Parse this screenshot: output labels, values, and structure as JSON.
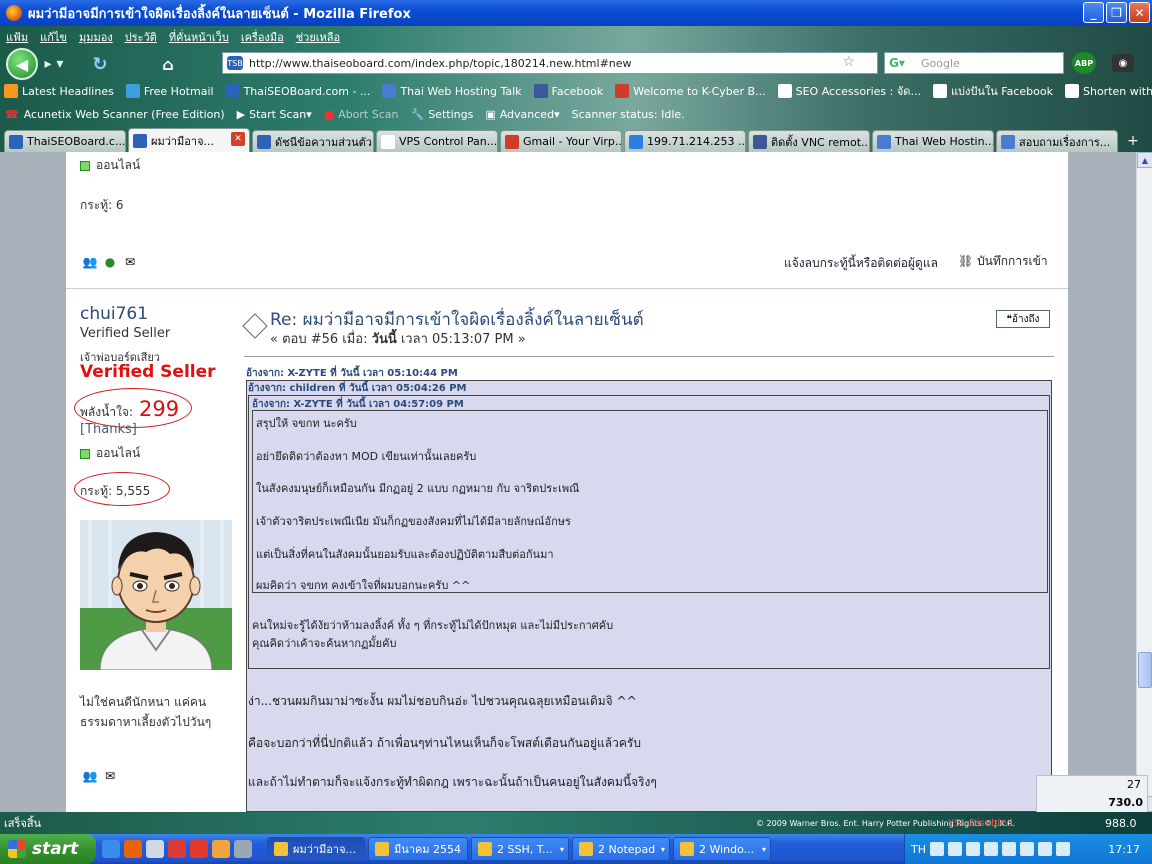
{
  "window": {
    "title": "ผมว่ามีอาจมีการเข้าใจผิดเรื่องลิ้งค์ในลายเซ็นต์ - Mozilla Firefox"
  },
  "menu": [
    "แฟ้ม",
    "แก้ไข",
    "มุมมอง",
    "ประวัติ",
    "ที่คั่นหน้าเว็บ",
    "เครื่องมือ",
    "ช่วยเหลือ"
  ],
  "nav": {
    "url": "http://www.thaiseoboard.com/index.php/topic,180214.new.html#new",
    "search_placeholder": "Google",
    "abp": "ABP"
  },
  "bookmarks": [
    {
      "label": "Latest Headlines",
      "color": "#f39a1e"
    },
    {
      "label": "Free Hotmail",
      "color": "#3aa0e0"
    },
    {
      "label": "ThaiSEOBoard.com - ...",
      "color": "#2a63b8"
    },
    {
      "label": "Thai Web Hosting Talk",
      "color": "#4a7bd0"
    },
    {
      "label": "Facebook",
      "color": "#3b5998"
    },
    {
      "label": "Welcome to K-Cyber B...",
      "color": "#d23a2a"
    },
    {
      "label": "SEO Accessories : จัด...",
      "color": "#ffffff"
    },
    {
      "label": "แบ่งปันใน Facebook",
      "color": "#ffffff"
    },
    {
      "label": "Shorten with bit.ly",
      "color": "#ffffff"
    }
  ],
  "acunetix": {
    "app": "Acunetix Web Scanner (Free Edition)",
    "start": "Start Scan",
    "abort": "Abort Scan",
    "settings": "Settings",
    "advanced": "Advanced",
    "status": "Scanner status: Idle."
  },
  "tabs": [
    {
      "label": "ThaiSEOBoard.c...",
      "active": false,
      "color": "#2a63b8"
    },
    {
      "label": "ผมว่ามีอาจ...",
      "active": true,
      "color": "#2a63b8"
    },
    {
      "label": "ดัชนีข้อความส่วนตัว",
      "active": false,
      "color": "#2a63b8"
    },
    {
      "label": "VPS Control Pan...",
      "active": false,
      "color": "#ffffff"
    },
    {
      "label": "Gmail - Your Virp...",
      "active": false,
      "color": "#d23a2a"
    },
    {
      "label": "199.71.214.253 ...",
      "active": false,
      "color": "#2a7fe0"
    },
    {
      "label": "ติดตั้ง VNC remot...",
      "active": false,
      "color": "#3b5998"
    },
    {
      "label": "Thai Web Hostin...",
      "active": false,
      "color": "#4a7bd0"
    },
    {
      "label": "สอบถามเรื่องการ...",
      "active": false,
      "color": "#4a7bd0"
    }
  ],
  "prev_post": {
    "online": "ออนไลน์",
    "posts": "กระทู้: 6",
    "report": "แจ้งลบกระทู้นี้หรือติดต่อผู้ดูแล",
    "log": "บันทึกการเข้า"
  },
  "post": {
    "username": "chui761",
    "user_title": "Verified Seller",
    "user_rank": "เจ้าพ่อบอร์ดเสียว",
    "verified": "Verified Seller",
    "power_label": "พลังน้ำใจ:",
    "power_value": "299",
    "thanks": "[Thanks]",
    "online": "ออนไลน์",
    "postcount": "กระทู้: 5,555",
    "signature": "ไม่ใช่คนดีนักหนา แค่คนธรรมดาหาเลี้ยงตัวไปวันๆ",
    "title": "Re: ผมว่ามีอาจมีการเข้าใจผิดเรื่องลิ้งค์ในลายเซ็นต์",
    "meta_prefix": "« ตอบ #56 เมื่อ:",
    "meta_day": "วันนี้",
    "meta_time": "เวลา 05:13:07 PM »",
    "quote_button": "อ้างถึง"
  },
  "quotes": {
    "q1_head": "อ้างจาก: X-ZYTE ที่ วันนี้ เวลา 05:10:44 PM",
    "q2_head": "อ้างจาก: children ที่ วันนี้ เวลา 05:04:26 PM",
    "q3_head": "อ้างจาก: X-ZYTE ที่ วันนี้ เวลา 04:57:09 PM",
    "q3_lines": [
      "สรุปให้ จขกท นะครับ",
      "อย่ายึดติดว่าต้องหา MOD เขียนเท่านั้นเลยครับ",
      "ในสังคงมนุษย์ก็เหมือนกัน มีกฏอยู่ 2 แบบ กฏหมาย กับ จาริตประเพณี",
      "เจ้าตัวจาริตประเพณีเนีย มันก็กฏของสังคมที่ไม่ได้มีลายลักษณ์อักษร",
      "แต่เป็นสิ่งที่คนในสังคมนั้นยอมรับและต้องปฏิบัติตามสืบต่อกันมา",
      "ผมคิดว่า จขกท คงเข้าใจที่ผมบอกนะครับ ^^"
    ],
    "q2_lines": [
      "คนใหม่จะรู้ได้งัยว่าห้ามลงลิ้งค์ ทั้ง ๆ ที่กระทู้ไม่ได้ปักหมุด และไม่มีประกาศคับ",
      "คุณคิดว่าเค้าจะค้นหากฏมั้ยคับ"
    ],
    "q1_lines": [
      "ง่า...ชวนผมกินมาม่าซะงั้น ผมไม่ชอบกินอ่ะ ไปชวนคุณฉลุยเหมือนเดิมจิ ^^",
      "คือจะบอกว่าที่นี่ปกติแล้ว ถ้าเพื่อนๆท่านไหนเห็นก็จะโพสต์เตือนกันอยู่แล้วครับ",
      "และถ้าไม่ทำตามก็จะแจ้งกระทู้ทำผิดกฎ เพราะฉะนั้นถ้าเป็นคนอยู่ในสังคมนี้จริงๆ"
    ]
  },
  "statusbar": {
    "text": "เสร็จสิ้น",
    "copyright": "© 2009 Warner Bros. Ent. Harry Potter Publishing Rights © J.K.R.",
    "disabled": "YSL Disabled"
  },
  "netpanel": {
    "top": "27",
    "bottom": "730.0",
    "extra": "988.0"
  },
  "taskbar": {
    "start": "start",
    "tasks": [
      {
        "label": "ผมว่ามีอาจ...",
        "active": true,
        "w": 98
      },
      {
        "label": "มีนาคม 2554",
        "active": false,
        "w": 100
      },
      {
        "label": "2 SSH, T...",
        "active": false,
        "w": 98
      },
      {
        "label": "2 Notepad",
        "active": false,
        "w": 98
      },
      {
        "label": "2 Windo...",
        "active": false,
        "w": 98
      }
    ],
    "lang": "TH",
    "clock": "17:17"
  }
}
